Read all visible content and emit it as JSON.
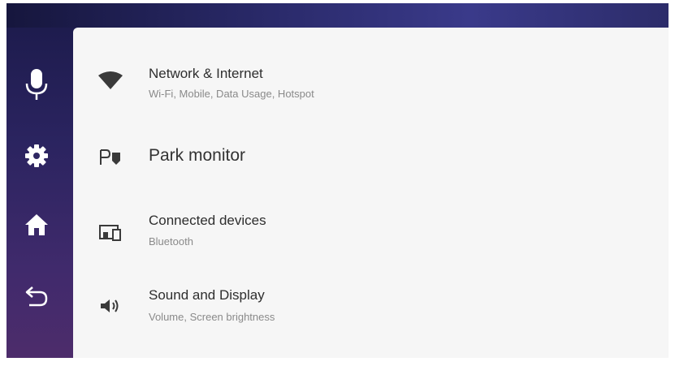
{
  "rail": {
    "items": [
      {
        "icon": "microphone-icon"
      },
      {
        "icon": "gear-icon"
      },
      {
        "icon": "home-icon"
      },
      {
        "icon": "back-arrow-icon"
      }
    ]
  },
  "settings": {
    "items": [
      {
        "icon": "wifi-icon",
        "title": "Network & Internet",
        "subtitle": "Wi-Fi, Mobile, Data Usage, Hotspot"
      },
      {
        "icon": "parking-camera-icon",
        "title": "Park monitor"
      },
      {
        "icon": "connected-devices-icon",
        "title": "Connected devices",
        "subtitle": "Bluetooth"
      },
      {
        "icon": "speaker-icon",
        "title": "Sound and Display",
        "subtitle": "Volume, Screen brightness"
      }
    ]
  },
  "colors": {
    "accent": "#ffffff",
    "rail_bg": "#2b2460",
    "panel_bg": "#f6f6f6",
    "icon": "#3a3a3a"
  }
}
